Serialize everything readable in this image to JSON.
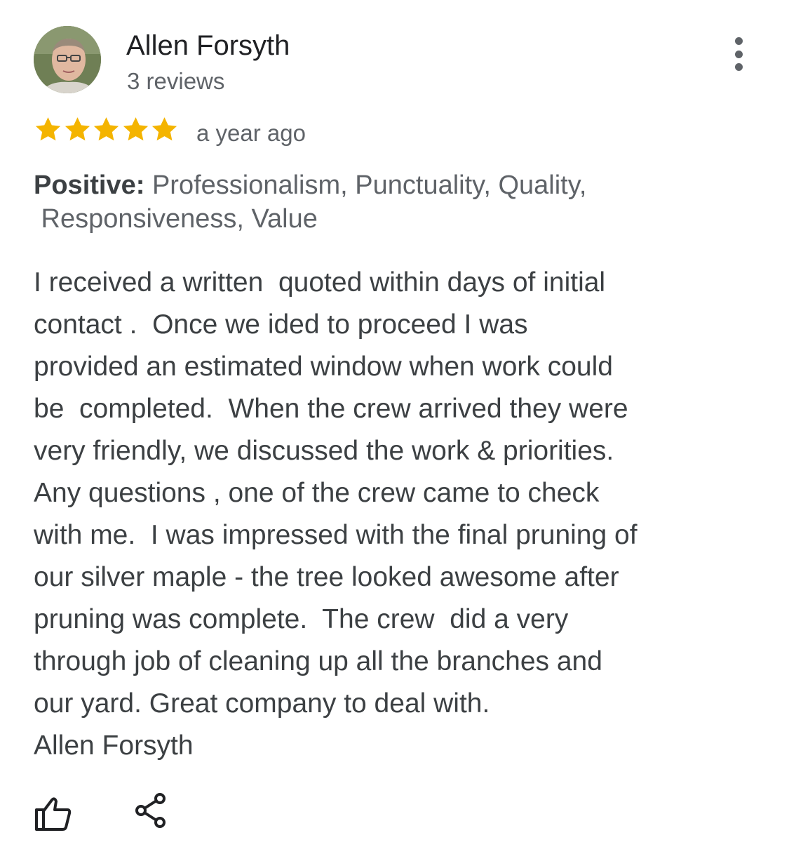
{
  "review": {
    "author": "Allen Forsyth",
    "review_count": "3 reviews",
    "rating": 5,
    "rating_max": 5,
    "time": "a year ago",
    "positive_label": "Positive:",
    "positive_line1": " Professionalism, Punctuality, Quality,",
    "positive_line2": " Responsiveness, Value",
    "text_lines": [
      "I received a written  quoted within days of initial",
      "contact .  Once we ided to proceed I was",
      "provided an estimated window when work could",
      "be  completed.  When the crew arrived they were",
      "very friendly, we discussed the work & priorities.",
      "Any questions , one of the crew came to check",
      "with me.  I was impressed with the final pruning of",
      "our silver maple - the tree looked awesome after",
      "pruning was complete.  The crew  did a very",
      "through job of cleaning up all the branches and",
      "our yard. Great company to deal with.",
      "Allen Forsyth"
    ]
  },
  "colors": {
    "star": "#f4b400",
    "text": "#3c4043",
    "muted": "#5f6368"
  },
  "icons": {
    "menu": "more-vert-icon",
    "like": "thumb-up-icon",
    "share": "share-icon"
  }
}
